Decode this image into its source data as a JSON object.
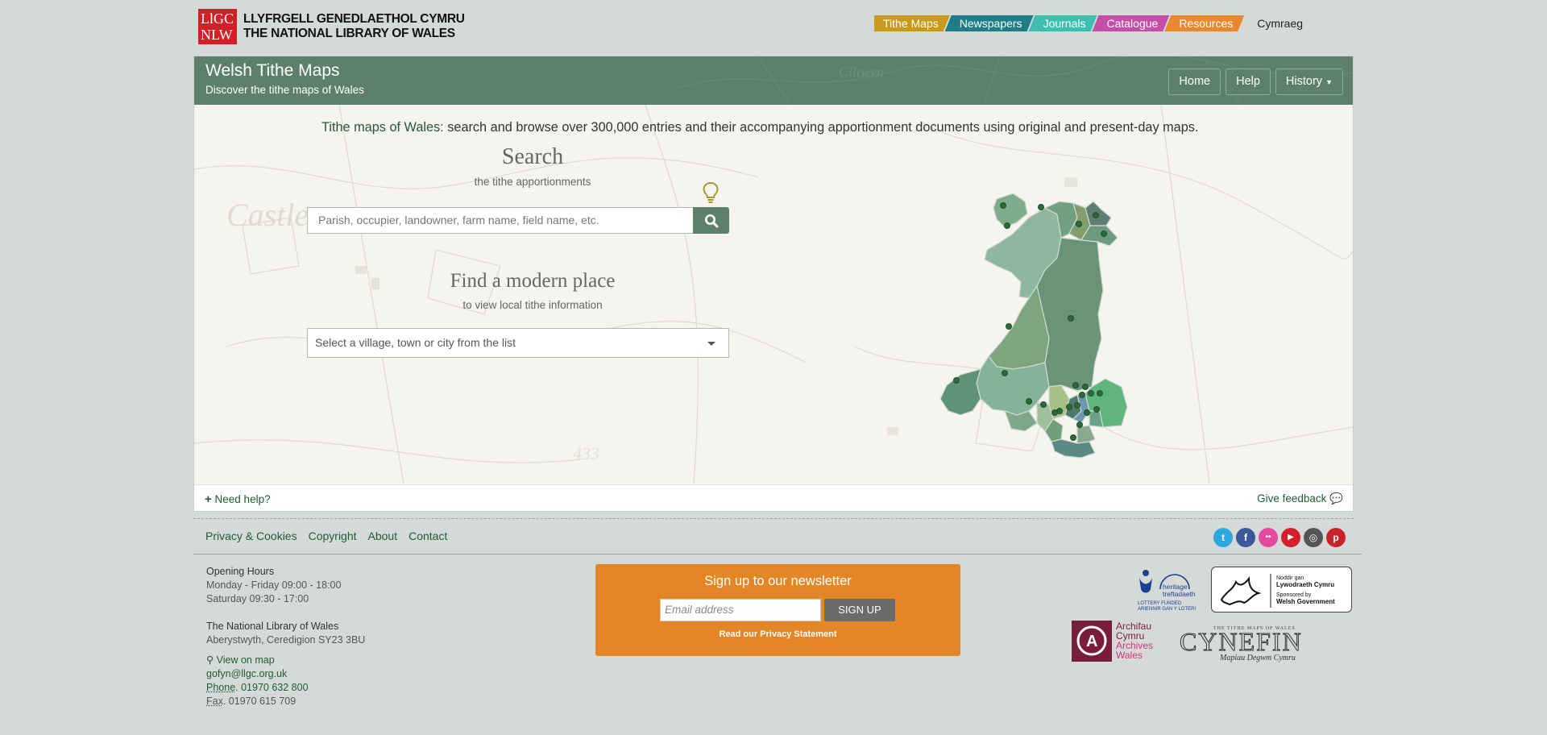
{
  "header": {
    "logo_box": "LlGC NLW",
    "logo_line1": "LLYFRGELL GENEDLAETHOL CYMRU",
    "logo_line2": "THE NATIONAL LIBRARY OF WALES",
    "nav": [
      {
        "label": "Tithe Maps",
        "color": "#c99a1a"
      },
      {
        "label": "Newspapers",
        "color": "#1e7d86"
      },
      {
        "label": "Journals",
        "color": "#3dbfb0"
      },
      {
        "label": "Catalogue",
        "color": "#c44fa8"
      },
      {
        "label": "Resources",
        "color": "#e8892e"
      }
    ],
    "language": "Cymraeg"
  },
  "banner": {
    "title": "Welsh Tithe Maps",
    "subtitle": "Discover the tithe maps of Wales",
    "nav": {
      "home": "Home",
      "help": "Help",
      "history": "History"
    }
  },
  "intro": {
    "highlight": "Tithe maps of Wales:",
    "text": " search and browse over 300,000 entries and their accompanying apportionment documents using original and present-day maps."
  },
  "search": {
    "title": "Search",
    "subtitle": "the tithe apportionments",
    "placeholder": "Parish, occupier, landowner, farm name, field name, etc.",
    "icon": "search-icon",
    "hint_icon": "lightbulb-icon"
  },
  "place": {
    "title": "Find a modern place",
    "subtitle": "to view local tithe information",
    "select_placeholder": "Select a village, town or city from the list"
  },
  "panel_footer": {
    "need_help": "Need help?",
    "feedback": "Give feedback"
  },
  "footer": {
    "links": [
      "Privacy & Cookies",
      "Copyright",
      "About",
      "Contact"
    ],
    "social": [
      {
        "name": "twitter-icon",
        "glyph": "t",
        "color": "#2ca7e0"
      },
      {
        "name": "facebook-icon",
        "glyph": "f",
        "color": "#3b5998"
      },
      {
        "name": "flickr-icon",
        "glyph": "••",
        "color": "#e6479f"
      },
      {
        "name": "youtube-icon",
        "glyph": "▶",
        "color": "#d4202a"
      },
      {
        "name": "instagram-icon",
        "glyph": "◎",
        "color": "#555555"
      },
      {
        "name": "pinterest-icon",
        "glyph": "p",
        "color": "#c8232c"
      }
    ],
    "opening_title": "Opening Hours",
    "opening_weekday": "Monday - Friday 09:00 - 18:00",
    "opening_saturday": "Saturday 09:30 - 17:00",
    "address_title": "The National Library of Wales",
    "address_line": "Aberystwyth, Ceredigion SY23 3BU",
    "view_on_map": "View on map",
    "email": "gofyn@llgc.org.uk",
    "phone_label": "Phone",
    "phone": "01970 632 800",
    "fax_label": "Fax",
    "fax": "01970 615 709"
  },
  "newsletter": {
    "title": "Sign up to our newsletter",
    "email_placeholder": "Email address",
    "button": "SIGN UP",
    "privacy": "Read our Privacy Statement"
  },
  "sponsors": {
    "heritage_line1": "heritage",
    "heritage_line2": "treftadaeth",
    "heritage_line3": "LOTTERY FUNDED",
    "heritage_line4": "ARIENNIR GAN Y LOTERI",
    "gov_line1": "Noddir gan",
    "gov_line2": "Lywodraeth Cymru",
    "gov_line3": "Sponsored by",
    "gov_line4": "Welsh Government",
    "archives_line1": "Archifau",
    "archives_line2": "Cymru",
    "archives_line3": "Archives",
    "archives_line4": "Wales",
    "cynefin_top": "THE TITHE MAPS OF WALES",
    "cynefin_main": "CYNEFIN",
    "cynefin_sub": "Mapiau Degwm Cymru"
  }
}
